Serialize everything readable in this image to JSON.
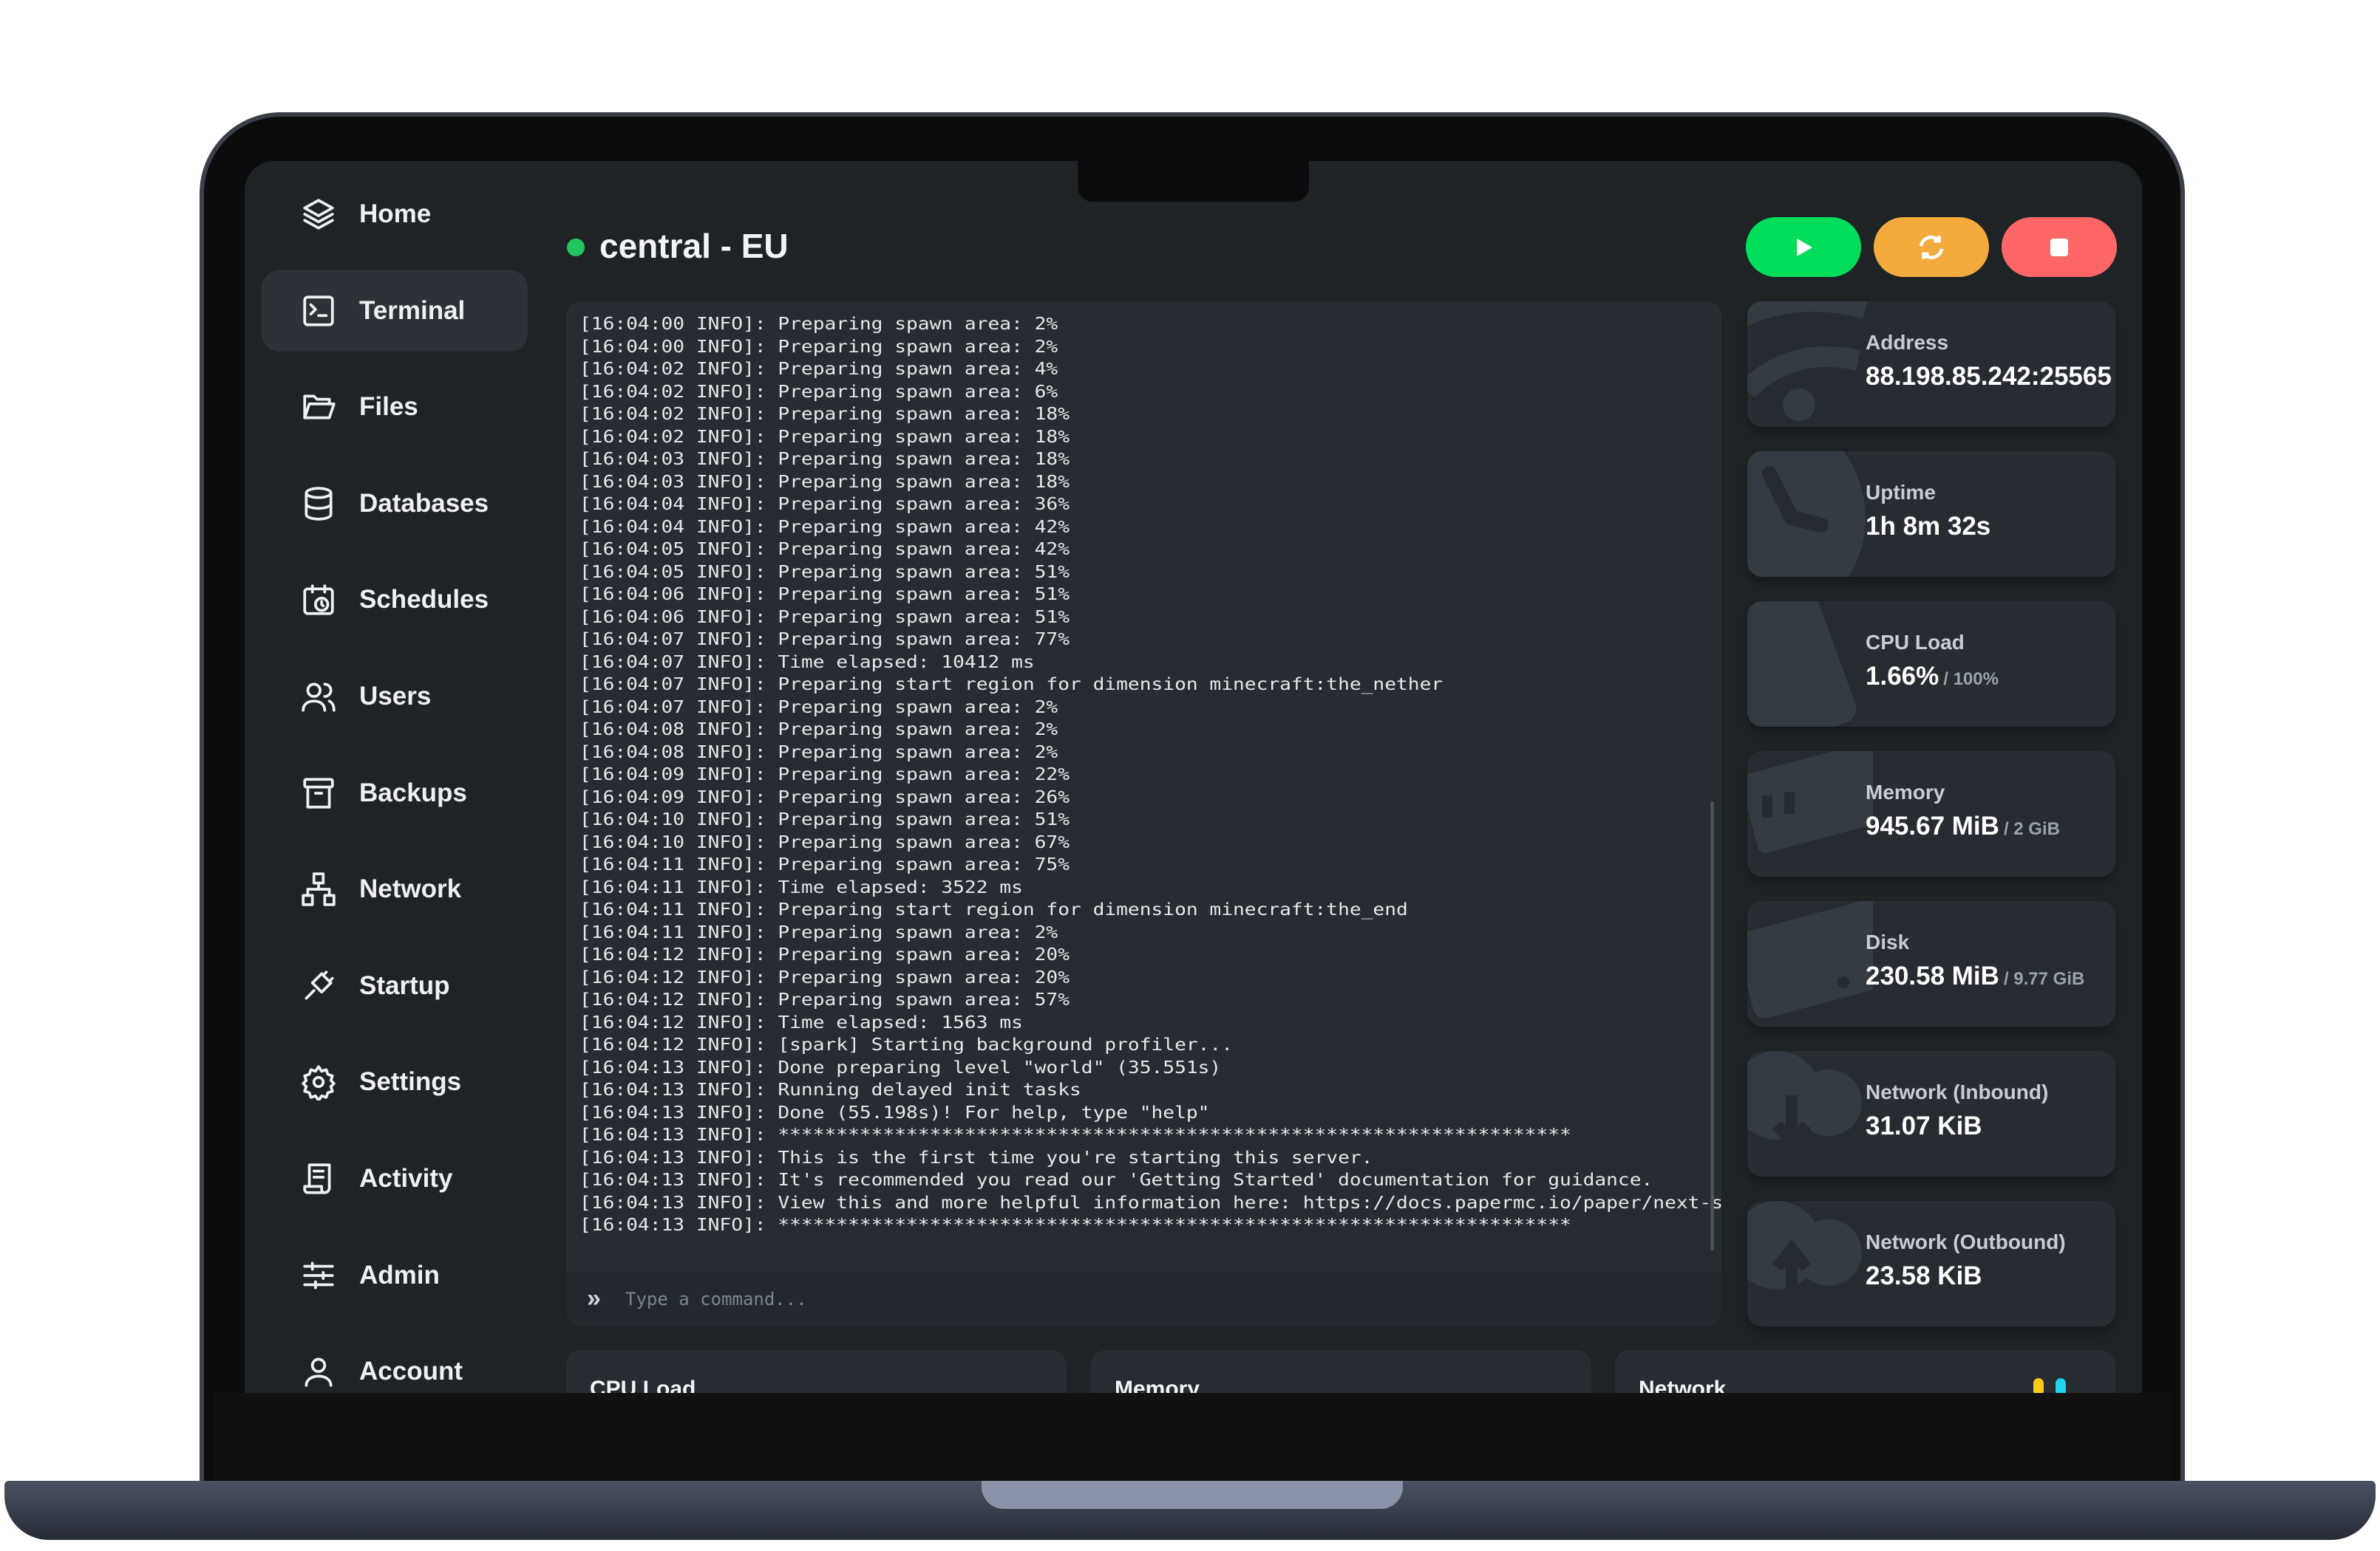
{
  "server": {
    "name": "central - EU",
    "status_color": "#22c55e"
  },
  "sidebar": {
    "items": [
      {
        "label": "Home",
        "icon": "layers-icon"
      },
      {
        "label": "Terminal",
        "icon": "terminal-icon",
        "active": true
      },
      {
        "label": "Files",
        "icon": "folder-icon"
      },
      {
        "label": "Databases",
        "icon": "database-icon"
      },
      {
        "label": "Schedules",
        "icon": "calendar-clock-icon"
      },
      {
        "label": "Users",
        "icon": "users-icon"
      },
      {
        "label": "Backups",
        "icon": "archive-icon"
      },
      {
        "label": "Network",
        "icon": "network-icon"
      },
      {
        "label": "Startup",
        "icon": "plug-icon"
      },
      {
        "label": "Settings",
        "icon": "gear-icon"
      },
      {
        "label": "Activity",
        "icon": "scroll-icon"
      },
      {
        "label": "Admin",
        "icon": "sliders-icon"
      },
      {
        "label": "Account",
        "icon": "user-icon"
      }
    ]
  },
  "power": {
    "start_color": "#00dd5b",
    "restart_color": "#f2ab3c",
    "stop_color": "#ff6666"
  },
  "terminal": {
    "lines": [
      "[16:04:00 INFO]: Preparing spawn area: 2%",
      "[16:04:00 INFO]: Preparing spawn area: 2%",
      "[16:04:02 INFO]: Preparing spawn area: 4%",
      "[16:04:02 INFO]: Preparing spawn area: 6%",
      "[16:04:02 INFO]: Preparing spawn area: 18%",
      "[16:04:02 INFO]: Preparing spawn area: 18%",
      "[16:04:03 INFO]: Preparing spawn area: 18%",
      "[16:04:03 INFO]: Preparing spawn area: 18%",
      "[16:04:04 INFO]: Preparing spawn area: 36%",
      "[16:04:04 INFO]: Preparing spawn area: 42%",
      "[16:04:05 INFO]: Preparing spawn area: 42%",
      "[16:04:05 INFO]: Preparing spawn area: 51%",
      "[16:04:06 INFO]: Preparing spawn area: 51%",
      "[16:04:06 INFO]: Preparing spawn area: 51%",
      "[16:04:07 INFO]: Preparing spawn area: 77%",
      "[16:04:07 INFO]: Time elapsed: 10412 ms",
      "[16:04:07 INFO]: Preparing start region for dimension minecraft:the_nether",
      "[16:04:07 INFO]: Preparing spawn area: 2%",
      "[16:04:08 INFO]: Preparing spawn area: 2%",
      "[16:04:08 INFO]: Preparing spawn area: 2%",
      "[16:04:09 INFO]: Preparing spawn area: 22%",
      "[16:04:09 INFO]: Preparing spawn area: 26%",
      "[16:04:10 INFO]: Preparing spawn area: 51%",
      "[16:04:10 INFO]: Preparing spawn area: 67%",
      "[16:04:11 INFO]: Preparing spawn area: 75%",
      "[16:04:11 INFO]: Time elapsed: 3522 ms",
      "[16:04:11 INFO]: Preparing start region for dimension minecraft:the_end",
      "[16:04:11 INFO]: Preparing spawn area: 2%",
      "[16:04:12 INFO]: Preparing spawn area: 20%",
      "[16:04:12 INFO]: Preparing spawn area: 20%",
      "[16:04:12 INFO]: Preparing spawn area: 57%",
      "[16:04:12 INFO]: Time elapsed: 1563 ms",
      "[16:04:12 INFO]: [spark] Starting background profiler...",
      "[16:04:13 INFO]: Done preparing level \"world\" (35.551s)",
      "[16:04:13 INFO]: Running delayed init tasks",
      "[16:04:13 INFO]: Done (55.198s)! For help, type \"help\"",
      "[16:04:13 INFO]: ********************************************************************",
      "[16:04:13 INFO]: This is the first time you're starting this server.",
      "[16:04:13 INFO]: It's recommended you read our 'Getting Started' documentation for guidance.",
      "[16:04:13 INFO]: View this and more helpful information here: https://docs.papermc.io/paper/next-steps",
      "[16:04:13 INFO]: ********************************************************************"
    ],
    "command_placeholder": "Type a command...",
    "prompt_icon": "chevrons-right-icon"
  },
  "stats": [
    {
      "label": "Address",
      "value": "88.198.85.242:25565",
      "icon": "wifi-icon"
    },
    {
      "label": "Uptime",
      "value": "1h 8m 32s",
      "icon": "clock-icon"
    },
    {
      "label": "CPU Load",
      "value": "1.66%",
      "max": "/ 100%",
      "icon": "cpu-icon"
    },
    {
      "label": "Memory",
      "value": "945.67 MiB",
      "max": "/ 2 GiB",
      "icon": "memory-icon"
    },
    {
      "label": "Disk",
      "value": "230.58 MiB",
      "max": "/ 9.77 GiB",
      "icon": "hdd-icon"
    },
    {
      "label": "Network (Inbound)",
      "value": "31.07 KiB",
      "icon": "cloud-download-icon"
    },
    {
      "label": "Network (Outbound)",
      "value": "23.58 KiB",
      "icon": "cloud-upload-icon"
    }
  ],
  "charts": [
    {
      "label": "CPU Load"
    },
    {
      "label": "Memory"
    },
    {
      "label": "Network",
      "legend_colors": [
        "#facc15",
        "#22d3ee"
      ]
    }
  ]
}
